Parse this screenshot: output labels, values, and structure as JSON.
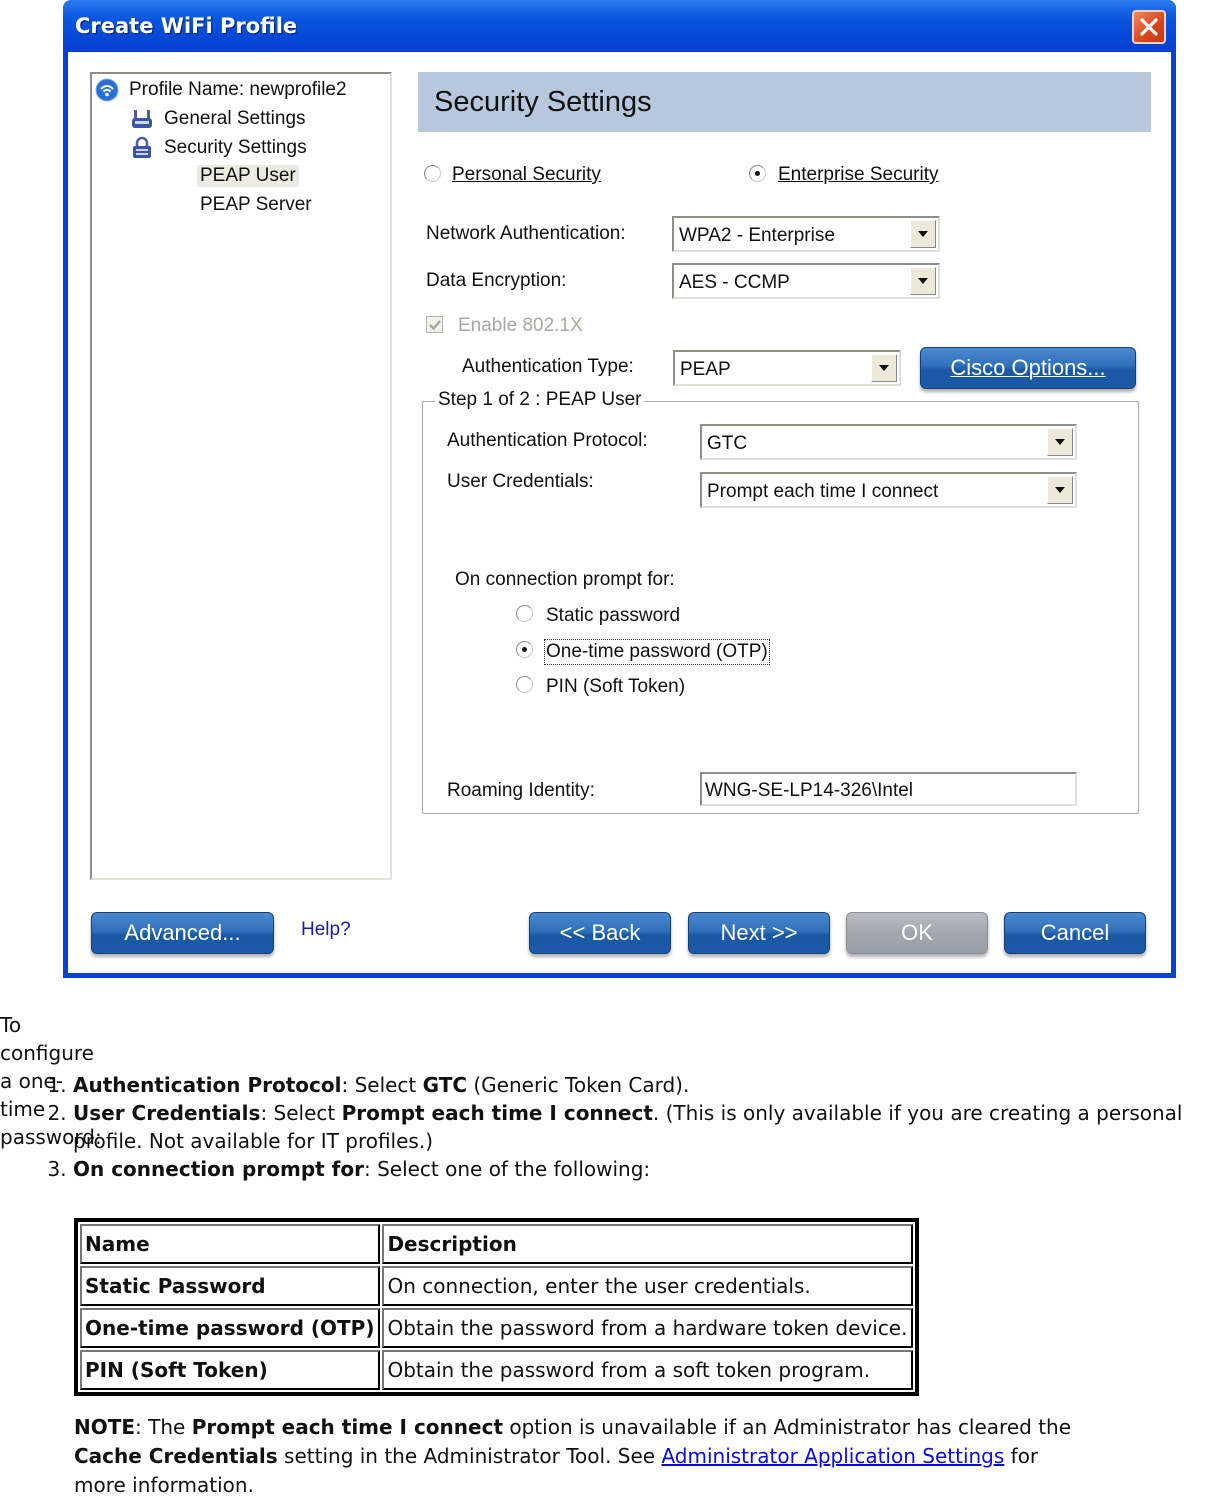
{
  "dialog": {
    "title": "Create WiFi Profile",
    "tree": {
      "profile_name": "Profile Name: newprofile2",
      "items": [
        {
          "label": "General Settings",
          "icon": "router-icon"
        },
        {
          "label": "Security Settings",
          "icon": "lock-icon"
        },
        {
          "label": "PEAP User",
          "selected": true
        },
        {
          "label": "PEAP Server"
        }
      ]
    },
    "header": "Security Settings",
    "security_mode": {
      "personal_label": "Personal Security",
      "enterprise_label": "Enterprise Security",
      "selected": "enterprise"
    },
    "network_authentication": {
      "label": "Network Authentication:",
      "value": "WPA2 - Enterprise"
    },
    "data_encryption": {
      "label": "Data Encryption:",
      "value": "AES - CCMP"
    },
    "enable_8021x": {
      "label": "Enable 802.1X",
      "checked": true,
      "disabled": true
    },
    "authentication_type": {
      "label": "Authentication Type:",
      "value": "PEAP"
    },
    "cisco_options_label": "Cisco Options...",
    "step_group": {
      "legend": "Step 1 of 2 : PEAP User",
      "authentication_protocol": {
        "label": "Authentication Protocol:",
        "value": "GTC"
      },
      "user_credentials": {
        "label": "User Credentials:",
        "value": "Prompt each time I connect"
      },
      "prompt_for": {
        "label": "On connection prompt for:",
        "options": [
          "Static password",
          "One-time password (OTP)",
          "PIN (Soft Token)"
        ],
        "selected_index": 1
      },
      "roaming_identity": {
        "label": "Roaming Identity:",
        "value": "WNG-SE-LP14-326\\Intel"
      }
    },
    "buttons": {
      "advanced": "Advanced...",
      "help": "Help?",
      "back": "<< Back",
      "next": "Next >>",
      "ok": "OK",
      "cancel": "Cancel"
    }
  },
  "document": {
    "intro": "To configure a one-time password:",
    "steps": [
      {
        "bold": "Authentication Protocol",
        "text1": ": Select ",
        "bold2": "GTC",
        "text2": " (Generic Token Card)."
      },
      {
        "bold": "User Credentials",
        "text1": ": Select ",
        "bold2": "Prompt each time I connect",
        "text2": ". (This is only available if you are creating a personal profile. Not available for IT profiles.)"
      },
      {
        "bold": "On connection prompt for",
        "text1": ": Select one of the following:",
        "bold2": "",
        "text2": ""
      }
    ],
    "table": {
      "headers": [
        "Name",
        "Description"
      ],
      "rows": [
        [
          "Static Password",
          "On connection, enter the user credentials."
        ],
        [
          "One-time password (OTP)",
          "Obtain the password from a hardware token device."
        ],
        [
          "PIN (Soft Token)",
          "Obtain the password from a soft token program."
        ]
      ]
    },
    "note": {
      "label": "NOTE",
      "t1": ": The ",
      "b1": "Prompt each time I connect",
      "t2": " option is unavailable if an Administrator has cleared the ",
      "b2": "Cache Credentials",
      "t3": " setting in the Administrator Tool. See ",
      "link": "Administrator Application Settings",
      "t4": " for more information."
    }
  }
}
